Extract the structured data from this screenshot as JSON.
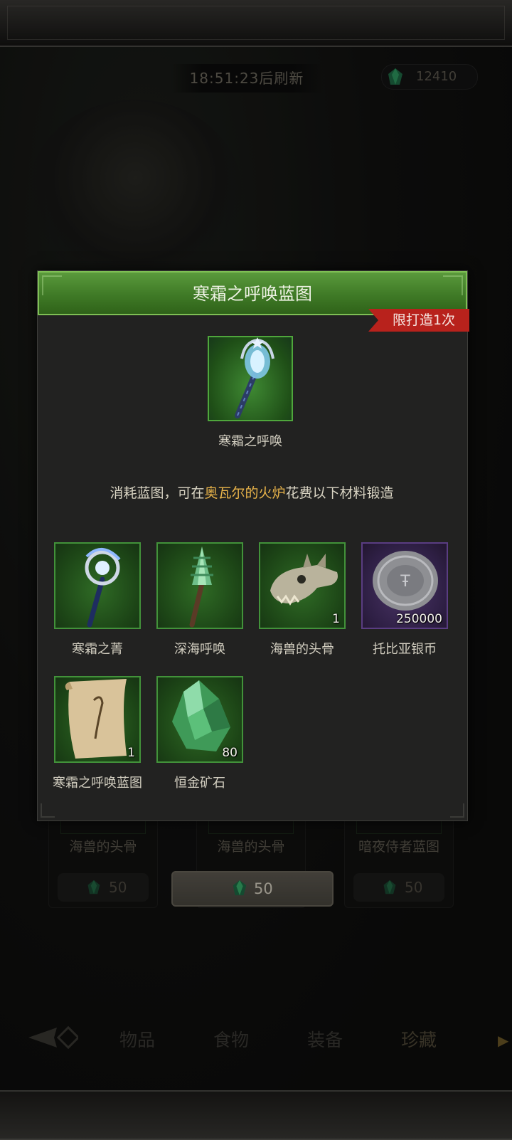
{
  "hud": {
    "timer": "18:51:23后刷新",
    "gems": "12410"
  },
  "shop": {
    "cards": [
      {
        "name": "海兽的头骨",
        "price": "50"
      },
      {
        "name": "海兽的头骨",
        "price": "50"
      },
      {
        "name": "暗夜侍者蓝图",
        "price": "50"
      }
    ],
    "buy_price": "50"
  },
  "tabs": [
    "物品",
    "食物",
    "装备",
    "珍藏"
  ],
  "modal": {
    "title": "寒霜之呼唤蓝图",
    "limit_tag": "限打造1次",
    "item_name": "寒霜之呼唤",
    "desc_prefix": "消耗蓝图，可在",
    "desc_highlight": "奥瓦尔的火炉",
    "desc_suffix": "花费以下材料锻造",
    "materials": [
      {
        "name": "寒霜之菁",
        "qty": "",
        "icon": "frost-scepter-icon"
      },
      {
        "name": "深海呼唤",
        "qty": "",
        "icon": "sea-shell-staff-icon"
      },
      {
        "name": "海兽的头骨",
        "qty": "1",
        "icon": "beast-skull-icon"
      },
      {
        "name": "托比亚银币",
        "qty": "250000",
        "icon": "silver-coin-icon"
      },
      {
        "name": "寒霜之呼唤蓝图",
        "qty": "1",
        "icon": "scroll-icon"
      },
      {
        "name": "恒金矿石",
        "qty": "80",
        "icon": "green-ore-icon"
      }
    ]
  },
  "colors": {
    "header_green": "#4a8a30",
    "highlight": "#e9b44a",
    "limit_red": "#b8221c"
  }
}
